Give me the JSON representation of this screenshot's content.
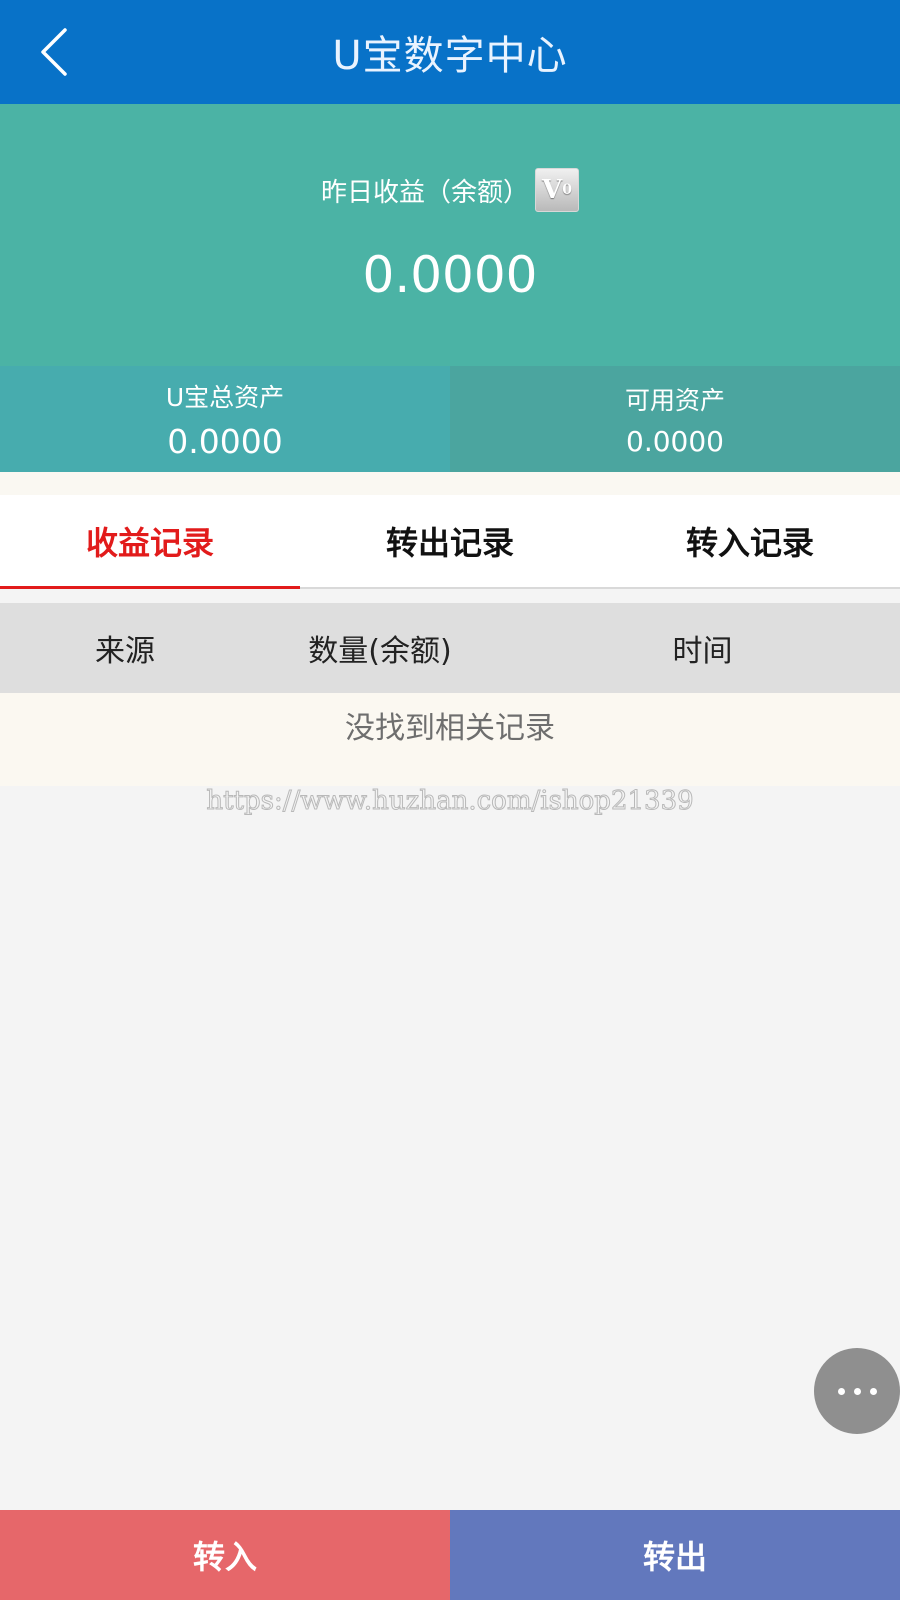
{
  "header": {
    "title": "U宝数字中心",
    "back_icon": "chevron-left-icon"
  },
  "hero": {
    "label": "昨日收益（余额）",
    "badge_text": "V",
    "badge_level": "0",
    "value": "0.0000"
  },
  "assets": {
    "total_label": "U宝总资产",
    "total_value": "0.0000",
    "available_label": "可用资产",
    "available_value": "0.0000"
  },
  "tabs": [
    {
      "label": "收益记录",
      "active": true
    },
    {
      "label": "转出记录",
      "active": false
    },
    {
      "label": "转入记录",
      "active": false
    }
  ],
  "table": {
    "columns": [
      "来源",
      "数量(余额)",
      "时间"
    ],
    "empty_text": "没找到相关记录"
  },
  "watermark": "https://www.huzhan.com/ishop21339",
  "float_menu_icon": "more-dots-icon",
  "bottom": {
    "in_label": "转入",
    "out_label": "转出"
  },
  "colors": {
    "header": "#0872c8",
    "hero": "#4bb3a5",
    "active_tab": "#e21b1b",
    "in_button": "#e6676a",
    "out_button": "#6278bd"
  }
}
